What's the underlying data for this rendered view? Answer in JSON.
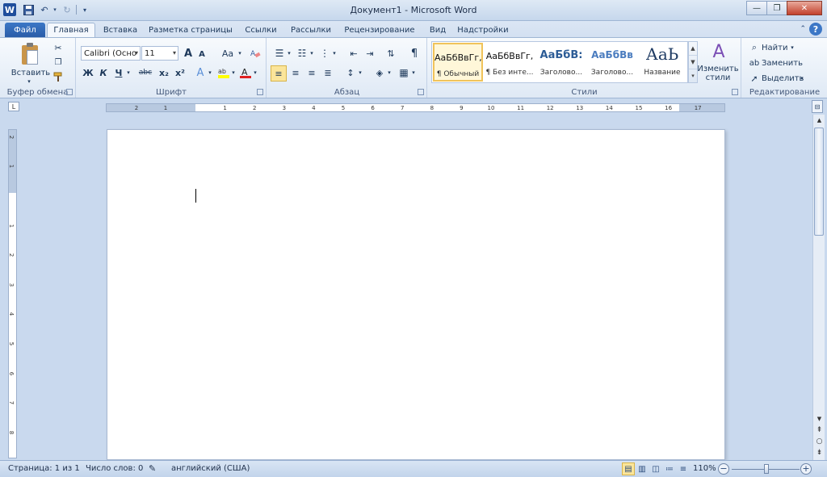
{
  "window": {
    "title": "Документ1 - Microsoft Word"
  },
  "qat": {
    "undo_icon": "undo-icon",
    "redo_icon": "redo-icon"
  },
  "tabs": [
    {
      "label": "Файл"
    },
    {
      "label": "Главная"
    },
    {
      "label": "Вставка"
    },
    {
      "label": "Разметка страницы"
    },
    {
      "label": "Ссылки"
    },
    {
      "label": "Рассылки"
    },
    {
      "label": "Рецензирование"
    },
    {
      "label": "Вид"
    },
    {
      "label": "Надстройки"
    }
  ],
  "ribbon": {
    "clipboard": {
      "label": "Буфер обмена",
      "paste": "Вставить"
    },
    "font": {
      "label": "Шрифт",
      "font_name": "Calibri (Осно",
      "font_size": "11",
      "bold": "Ж",
      "italic": "К",
      "underline": "Ч",
      "strike": "abc",
      "subscript": "x₂",
      "superscript": "x²",
      "grow": "A",
      "shrink": "A",
      "case": "Aa"
    },
    "paragraph": {
      "label": "Абзац",
      "pilcrow": "¶"
    },
    "styles": {
      "label": "Стили",
      "items": [
        {
          "sample": "АаБбВвГг,",
          "name": "¶ Обычный"
        },
        {
          "sample": "АаБбВвГг,",
          "name": "¶ Без инте..."
        },
        {
          "sample": "АаБбВ:",
          "name": "Заголово..."
        },
        {
          "sample": "АаБбВв",
          "name": "Заголово..."
        },
        {
          "sample": "АаЬ",
          "name": "Название"
        }
      ],
      "change": "Изменить стили"
    },
    "editing": {
      "label": "Редактирование",
      "find": "Найти",
      "replace": "Заменить",
      "select": "Выделить"
    }
  },
  "ruler": {
    "ticks": [
      "2",
      "1",
      "1",
      "2",
      "3",
      "4",
      "5",
      "6",
      "7",
      "8",
      "9",
      "10",
      "11",
      "12",
      "13",
      "14",
      "15",
      "16",
      "17"
    ]
  },
  "vruler": {
    "ticks": [
      "2",
      "1",
      "1",
      "2",
      "3",
      "4",
      "5",
      "6",
      "7",
      "8",
      "9"
    ]
  },
  "status": {
    "page": "Страница: 1 из 1",
    "words": "Число слов: 0",
    "language": "английский (США)",
    "zoom": "110%",
    "zoom_value": 110
  },
  "colors": {
    "accent": "#2a5da8",
    "highlight": "#ffff00",
    "font_color": "#e02020",
    "selected_border": "#f0c35a"
  }
}
